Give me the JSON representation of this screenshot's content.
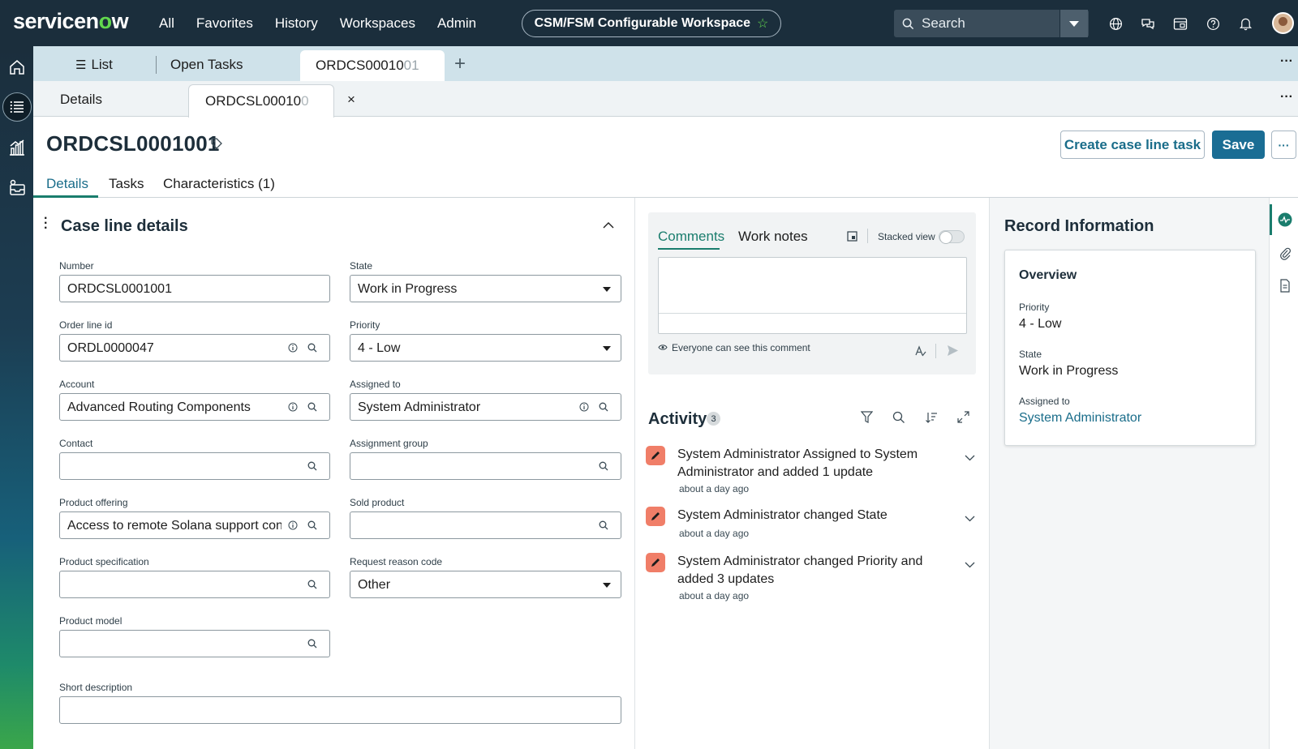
{
  "topbar": {
    "logo_pre": "servicen",
    "logo_o": "o",
    "logo_post": "w",
    "nav": [
      "All",
      "Favorites",
      "History",
      "Workspaces",
      "Admin"
    ],
    "workspace": "CSM/FSM Configurable Workspace",
    "search_placeholder": "Search",
    "icons": [
      "globe-icon",
      "chat-icon",
      "inbox-icon",
      "help-icon",
      "bell-icon",
      "user-avatar"
    ]
  },
  "tabstrip1": {
    "list_label": "List",
    "open_tasks": "Open Tasks",
    "active_tab_main": "ORDCS00010",
    "active_tab_fade": "01"
  },
  "tabstrip2": {
    "details": "Details",
    "active_tab_main": "ORDCSL00010",
    "active_tab_fade": "0"
  },
  "header": {
    "title": "ORDCSL0001001",
    "create_button": "Create case line task",
    "save_button": "Save"
  },
  "subtabs": [
    "Details",
    "Tasks",
    "Characteristics (1)"
  ],
  "form": {
    "section_title": "Case line details",
    "fields": {
      "number": {
        "label": "Number",
        "value": "ORDCSL0001001"
      },
      "state": {
        "label": "State",
        "value": "Work in Progress"
      },
      "order_line": {
        "label": "Order line id",
        "value": "ORDL0000047"
      },
      "priority": {
        "label": "Priority",
        "value": "4 - Low"
      },
      "account": {
        "label": "Account",
        "value": "Advanced Routing Components"
      },
      "assigned_to": {
        "label": "Assigned to",
        "value": "System Administrator"
      },
      "contact": {
        "label": "Contact",
        "value": ""
      },
      "assignment_group": {
        "label": "Assignment group",
        "value": ""
      },
      "product_offering": {
        "label": "Product offering",
        "value": "Access to remote Solana support contr"
      },
      "sold_product": {
        "label": "Sold product",
        "value": ""
      },
      "product_spec": {
        "label": "Product specification",
        "value": ""
      },
      "request_reason": {
        "label": "Request reason code",
        "value": "Other"
      },
      "product_model": {
        "label": "Product model",
        "value": ""
      },
      "short_description": {
        "label": "Short description",
        "value": ""
      }
    }
  },
  "comments": {
    "tab_comments": "Comments",
    "tab_worknotes": "Work notes",
    "stacked_view": "Stacked view",
    "visibility": "Everyone can see this comment"
  },
  "activity": {
    "title": "Activity",
    "count": "3",
    "items": [
      {
        "text": "System Administrator Assigned to System Administrator and added 1 update",
        "time": "about a day ago"
      },
      {
        "text": "System Administrator changed State",
        "time": "about a day ago"
      },
      {
        "text": "System Administrator changed Priority and added 3 updates",
        "time": "about a day ago"
      }
    ]
  },
  "record_info": {
    "title": "Record Information",
    "overview": "Overview",
    "priority_label": "Priority",
    "priority_value": "4 - Low",
    "state_label": "State",
    "state_value": "Work in Progress",
    "assigned_label": "Assigned to",
    "assigned_value": "System Administrator"
  },
  "colors": {
    "topbar": "#1b2e3c",
    "accent_green": "#62d84e",
    "link_teal": "#1a6d8a",
    "save_blue": "#1a6d94",
    "activity_badge": "#f07e68"
  }
}
